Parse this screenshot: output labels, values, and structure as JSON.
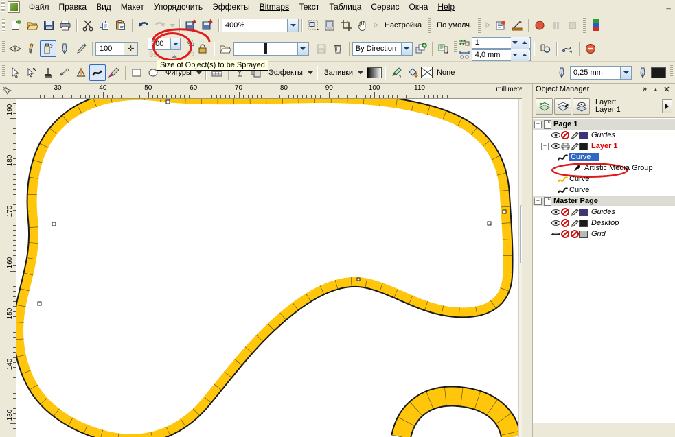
{
  "menubar": {
    "items": [
      {
        "label": "Файл"
      },
      {
        "label": "Правка"
      },
      {
        "label": "Вид"
      },
      {
        "label": "Макет"
      },
      {
        "label": "Упорядочить"
      },
      {
        "label": "Эффекты"
      },
      {
        "label": "Bitmaps"
      },
      {
        "label": "Текст"
      },
      {
        "label": "Таблица"
      },
      {
        "label": "Сервис"
      },
      {
        "label": "Окна"
      },
      {
        "label": "Help"
      }
    ],
    "minimize": "_"
  },
  "toolbar_standard": {
    "zoom_level": "400%",
    "preset_label": "Настройка",
    "default_label": "По умолч."
  },
  "toolbar_sprayer": {
    "size_value": "100",
    "scale_value": "300",
    "scale_value_secondary": "99",
    "percent_symbol": "%",
    "stroke_preset": "",
    "order_value": "By Direction",
    "dabs_value": "1",
    "spacing_value": "4,0 mm",
    "tooltip": "Size of Object(s) to be Sprayed"
  },
  "toolbar_property": {
    "shapes_label": "Фигуры",
    "effects_label": "Эффекты",
    "fills_label": "Заливки",
    "outline_none_label": "None",
    "outline_width": "0,25 mm"
  },
  "rulers": {
    "unit_label": "millimeters",
    "h_ticks": [
      30,
      40,
      50,
      60,
      70,
      80,
      90,
      100,
      110
    ],
    "v_ticks": [
      190,
      180,
      170,
      160,
      150,
      140,
      130
    ]
  },
  "docker": {
    "title": "Object Manager",
    "collapse_icon": "»",
    "up_icon": "▲",
    "close_icon": "✕",
    "layer_line1": "Layer:",
    "layer_line2": "Layer 1",
    "tree": [
      {
        "label": "Page 1",
        "kind": "page",
        "expander": "−",
        "depth": 0
      },
      {
        "label": "Guides",
        "kind": "layer",
        "depth": 1,
        "color": "#3b3280",
        "italic": true
      },
      {
        "label": "Layer 1",
        "kind": "layer",
        "expander": "−",
        "depth": 1,
        "color": "#1b1b1b",
        "red": true
      },
      {
        "label": "Curve",
        "kind": "object",
        "depth": 2,
        "selected": true,
        "curve_color": "#1b1b1b"
      },
      {
        "label": "Artistic Media Group",
        "kind": "group",
        "depth": 3
      },
      {
        "label": "Curve",
        "kind": "object",
        "depth": 2,
        "curve_color": "#f2b600"
      },
      {
        "label": "Curve",
        "kind": "object",
        "depth": 2,
        "curve_color": "#1b1b1b"
      },
      {
        "label": "Master Page",
        "kind": "page",
        "expander": "−",
        "depth": 0
      },
      {
        "label": "Guides",
        "kind": "layer",
        "depth": 1,
        "color": "#3b3280",
        "italic": true
      },
      {
        "label": "Desktop",
        "kind": "layer",
        "depth": 1,
        "color": "#1b1b1b",
        "italic": true
      },
      {
        "label": "Grid",
        "kind": "layer",
        "depth": 1,
        "color": "#b8b8b8",
        "italic": true,
        "grid": true
      }
    ]
  },
  "artwork": {
    "band_fill": "#FFC60B",
    "band_stroke": "#1a1a1a",
    "canvas_bg": "#ffffff"
  },
  "colors": {
    "chrome": "#ece9d8",
    "annotation_red": "#e01b1b",
    "selection_blue": "#3067c4"
  }
}
